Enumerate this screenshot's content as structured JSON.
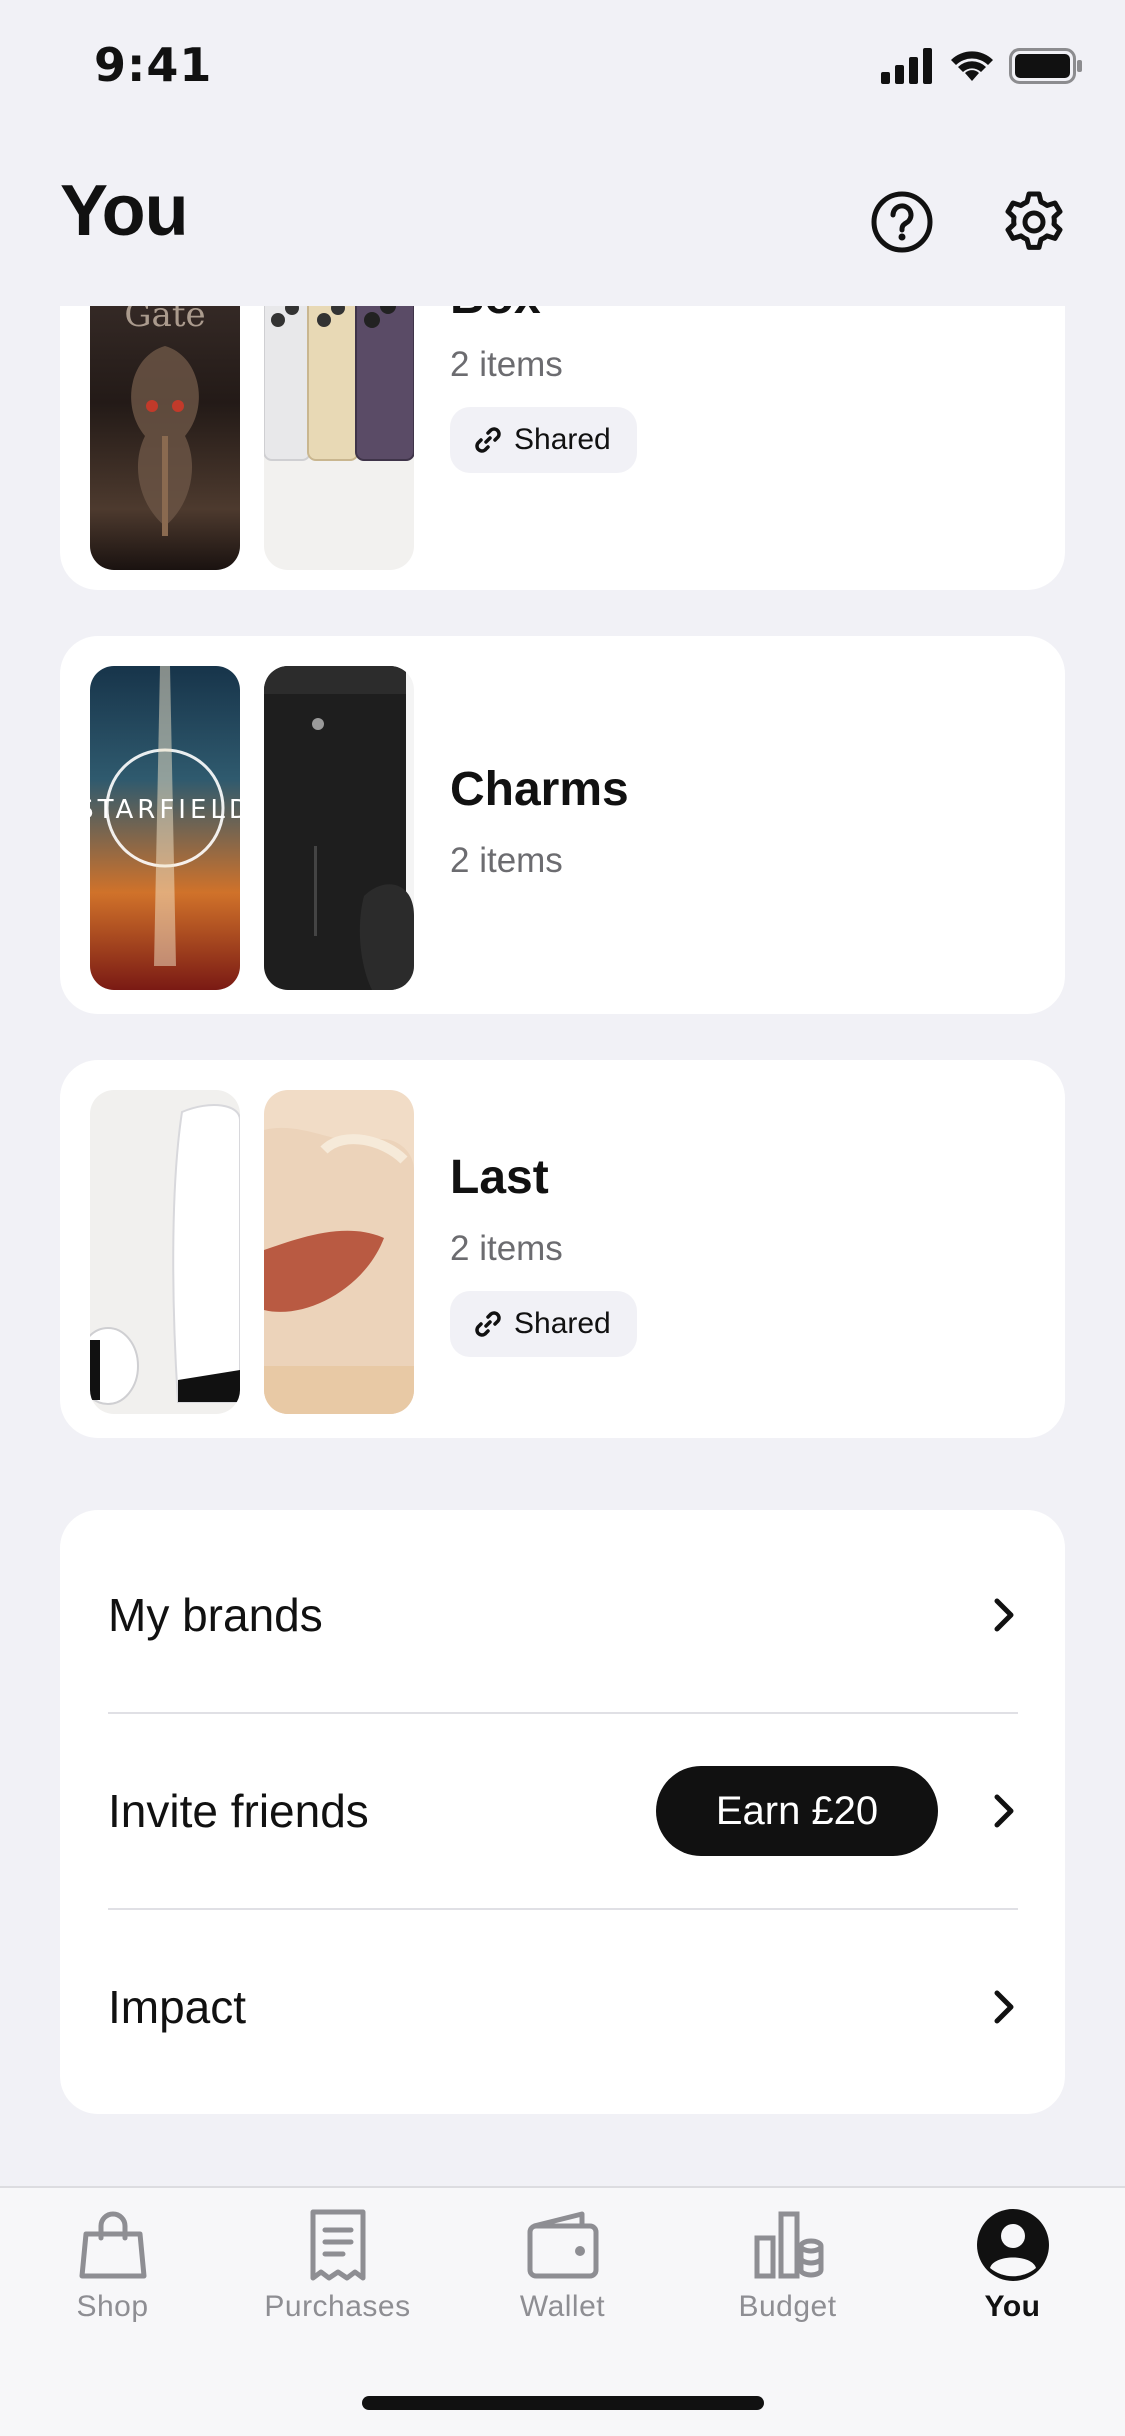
{
  "status_bar": {
    "time": "9:41"
  },
  "header": {
    "title": "You"
  },
  "collections": [
    {
      "title": "Box",
      "count": "2 items",
      "shared": true,
      "shared_label": "Shared",
      "thumbs": [
        {
          "kind": "game-art",
          "text": "Baldur's Gate",
          "colors": [
            "#3a2d29",
            "#1b1412",
            "#7a5b45"
          ]
        },
        {
          "kind": "phones",
          "colors": [
            "#e8e8ea",
            "#e8d9b5",
            "#5a4b66"
          ]
        }
      ]
    },
    {
      "title": "Charms",
      "count": "2 items",
      "shared": false,
      "thumbs": [
        {
          "kind": "game-art",
          "text": "STARFIELD",
          "colors": [
            "#17344a",
            "#d0722a",
            "#7a1a14"
          ]
        },
        {
          "kind": "console",
          "colors": [
            "#1a1a1a",
            "#2a2a2a"
          ]
        }
      ]
    },
    {
      "title": "Last",
      "count": "2 items",
      "shared": true,
      "shared_label": "Shared",
      "thumbs": [
        {
          "kind": "ps5",
          "colors": [
            "#f2f2f2",
            "#ffffff",
            "#111111"
          ]
        },
        {
          "kind": "sneaker",
          "colors": [
            "#f1dcc6",
            "#b95a42",
            "#e8c9a5"
          ]
        }
      ]
    }
  ],
  "menu": {
    "items": [
      {
        "label": "My brands"
      },
      {
        "label": "Invite friends",
        "badge": "Earn £20"
      },
      {
        "label": "Impact"
      }
    ]
  },
  "tabs": [
    {
      "label": "Shop",
      "icon": "bag-icon"
    },
    {
      "label": "Purchases",
      "icon": "receipt-icon"
    },
    {
      "label": "Wallet",
      "icon": "wallet-icon"
    },
    {
      "label": "Budget",
      "icon": "budget-icon"
    },
    {
      "label": "You",
      "icon": "person-icon",
      "active": true
    }
  ]
}
